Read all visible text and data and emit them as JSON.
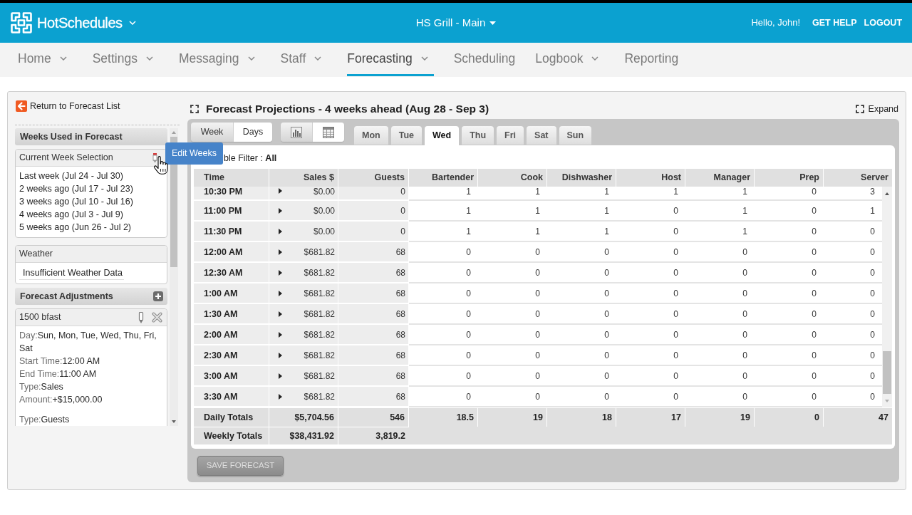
{
  "header": {
    "brand": "HotSchedules",
    "location": "HS Grill - Main",
    "greeting": "Hello, John!",
    "links": [
      "GET HELP",
      "LOGOUT"
    ]
  },
  "nav": [
    {
      "label": "Home",
      "dropdown": true,
      "selected": false
    },
    {
      "label": "Settings",
      "dropdown": true,
      "selected": false
    },
    {
      "label": "Messaging",
      "dropdown": true,
      "selected": false
    },
    {
      "label": "Staff",
      "dropdown": true,
      "selected": false
    },
    {
      "label": "Forecasting",
      "dropdown": true,
      "selected": true
    },
    {
      "label": "Scheduling",
      "dropdown": false,
      "selected": false
    },
    {
      "label": "Logbook",
      "dropdown": true,
      "selected": false
    },
    {
      "label": "Reporting",
      "dropdown": false,
      "selected": false
    }
  ],
  "sidebar": {
    "back_link": "Return to Forecast List",
    "weeks_section": {
      "title": "Weeks Used in Forecast",
      "card_title": "Current Week Selection",
      "weeks": [
        "Last week (Jul 24 - Jul 30)",
        "2 weeks ago (Jul 17 - Jul 23)",
        "3 weeks ago (Jul 10 - Jul 16)",
        "4 weeks ago (Jul 3 - Jul 9)",
        "5 weeks ago (Jun 26 - Jul 2)"
      ]
    },
    "tooltip": "Edit Weeks",
    "weather": {
      "title": "Weather",
      "message": "Insufficient Weather Data"
    },
    "adjustments_section": {
      "title": "Forecast Adjustments",
      "items": [
        {
          "name": "1500 bfast",
          "groups": [
            [
              {
                "label": "Day:",
                "value": "Sun, Mon, Tue, Wed, Thu, Fri, Sat"
              },
              {
                "label": "Start Time:",
                "value": "12:00 AM"
              },
              {
                "label": "End Time:",
                "value": "11:00 AM"
              },
              {
                "label": "Type:",
                "value": "Sales"
              },
              {
                "label": "Amount:",
                "value": "+$15,000.00"
              }
            ],
            [
              {
                "label": "Type:",
                "value": "Guests"
              }
            ]
          ]
        }
      ]
    }
  },
  "forecast": {
    "title": "Forecast Projections - 4 weeks ahead (Aug 28 - Sep 3)",
    "expand": "Expand",
    "view_toggle": [
      {
        "label": "Week",
        "selected": false
      },
      {
        "label": "Days",
        "selected": true
      }
    ],
    "display_toggle": [
      {
        "kind": "chart",
        "selected": false
      },
      {
        "kind": "table",
        "selected": true
      }
    ],
    "day_tabs": [
      {
        "label": "Mon",
        "selected": false
      },
      {
        "label": "Tue",
        "selected": false
      },
      {
        "label": "Wed",
        "selected": true
      },
      {
        "label": "Thu",
        "selected": false
      },
      {
        "label": "Fri",
        "selected": false
      },
      {
        "label": "Sat",
        "selected": false
      },
      {
        "label": "Sun",
        "selected": false
      }
    ],
    "filter": "ble Filter : **All**",
    "table": {
      "columns": [
        "Time",
        "Sales $",
        "Guests",
        "Bartender",
        "Cook",
        "Dishwasher",
        "Host",
        "Manager",
        "Prep",
        "Server"
      ],
      "rows": [
        {
          "time": "10:30 PM",
          "values": [
            "$0.00",
            "0",
            "1",
            "1",
            "1",
            "1",
            "1",
            "0",
            "3"
          ]
        },
        {
          "time": "11:00 PM",
          "values": [
            "$0.00",
            "0",
            "1",
            "1",
            "1",
            "0",
            "1",
            "0",
            "1"
          ]
        },
        {
          "time": "11:30 PM",
          "values": [
            "$0.00",
            "0",
            "1",
            "1",
            "1",
            "0",
            "1",
            "0",
            "0"
          ]
        },
        {
          "time": "12:00 AM",
          "values": [
            "$681.82",
            "68",
            "0",
            "0",
            "0",
            "0",
            "0",
            "0",
            "0"
          ]
        },
        {
          "time": "12:30 AM",
          "values": [
            "$681.82",
            "68",
            "0",
            "0",
            "0",
            "0",
            "0",
            "0",
            "0"
          ]
        },
        {
          "time": "1:00 AM",
          "values": [
            "$681.82",
            "68",
            "0",
            "0",
            "0",
            "0",
            "0",
            "0",
            "0"
          ]
        },
        {
          "time": "1:30 AM",
          "values": [
            "$681.82",
            "68",
            "0",
            "0",
            "0",
            "0",
            "0",
            "0",
            "0"
          ]
        },
        {
          "time": "2:00 AM",
          "values": [
            "$681.82",
            "68",
            "0",
            "0",
            "0",
            "0",
            "0",
            "0",
            "0"
          ]
        },
        {
          "time": "2:30 AM",
          "values": [
            "$681.82",
            "68",
            "0",
            "0",
            "0",
            "0",
            "0",
            "0",
            "0"
          ]
        },
        {
          "time": "3:00 AM",
          "values": [
            "$681.82",
            "68",
            "0",
            "0",
            "0",
            "0",
            "0",
            "0",
            "0"
          ]
        },
        {
          "time": "3:30 AM",
          "values": [
            "$681.82",
            "68",
            "0",
            "0",
            "0",
            "0",
            "0",
            "0",
            "0"
          ]
        }
      ],
      "totals": [
        {
          "label": "Daily Totals",
          "values": [
            "$5,704.56",
            "546",
            "18.5",
            "19",
            "18",
            "17",
            "19",
            "0",
            "47"
          ]
        },
        {
          "label": "Weekly Totals",
          "values": [
            "$38,431.92",
            "3,819.2"
          ]
        }
      ]
    },
    "save_button": {
      "label": "SAVE FORECAST",
      "disabled": true
    }
  }
}
